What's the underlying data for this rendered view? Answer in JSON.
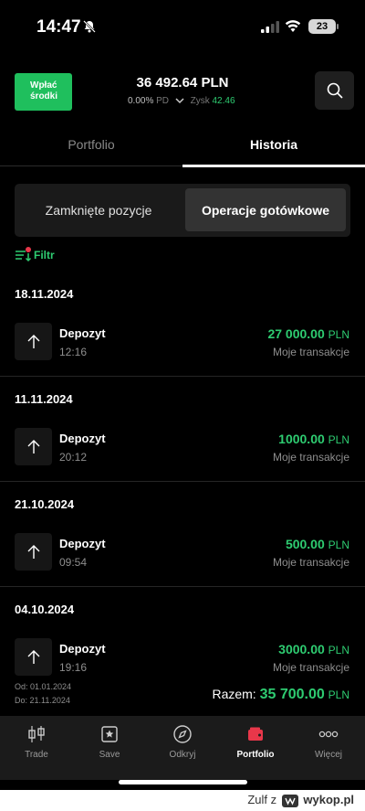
{
  "status_bar": {
    "time": "14:47",
    "battery": "23"
  },
  "header": {
    "deposit_line1": "Wpłać",
    "deposit_line2": "środki",
    "balance": "36 492.64 PLN",
    "change_pct": "0.00%",
    "change_period": "PD",
    "profit_label": "Zysk",
    "profit_value": "42.46"
  },
  "tabs": {
    "portfolio": "Portfolio",
    "historia": "Historia"
  },
  "segments": {
    "closed": "Zamknięte pozycje",
    "cash": "Operacje gotówkowe"
  },
  "filter_label": "Filtr",
  "groups": [
    {
      "date": "18.11.2024",
      "title": "Depozyt",
      "time": "12:16",
      "amount": "27 000.00",
      "currency": "PLN",
      "source": "Moje transakcje"
    },
    {
      "date": "11.11.2024",
      "title": "Depozyt",
      "time": "20:12",
      "amount": "1000.00",
      "currency": "PLN",
      "source": "Moje transakcje"
    },
    {
      "date": "21.10.2024",
      "title": "Depozyt",
      "time": "09:54",
      "amount": "500.00",
      "currency": "PLN",
      "source": "Moje transakcje"
    },
    {
      "date": "04.10.2024",
      "title": "Depozyt",
      "time": "19:16",
      "amount": "3000.00",
      "currency": "PLN",
      "source": "Moje transakcje"
    }
  ],
  "summary": {
    "from": "Od: 01.01.2024",
    "to": "Do: 21.11.2024",
    "total_label": "Razem:",
    "total_value": "35 700.00",
    "currency": "PLN"
  },
  "nav": [
    {
      "label": "Trade",
      "icon": "trade-icon"
    },
    {
      "label": "Save",
      "icon": "save-icon"
    },
    {
      "label": "Odkryj",
      "icon": "compass-icon"
    },
    {
      "label": "Portfolio",
      "icon": "wallet-icon",
      "active": true
    },
    {
      "label": "Więcej",
      "icon": "more-icon"
    }
  ],
  "watermark": {
    "user": "Zulf",
    "site": "wykop.pl"
  },
  "colors": {
    "accent": "#2ecc71",
    "button": "#1fbf5d",
    "background": "#000000",
    "nav_active": "#e8374a"
  }
}
